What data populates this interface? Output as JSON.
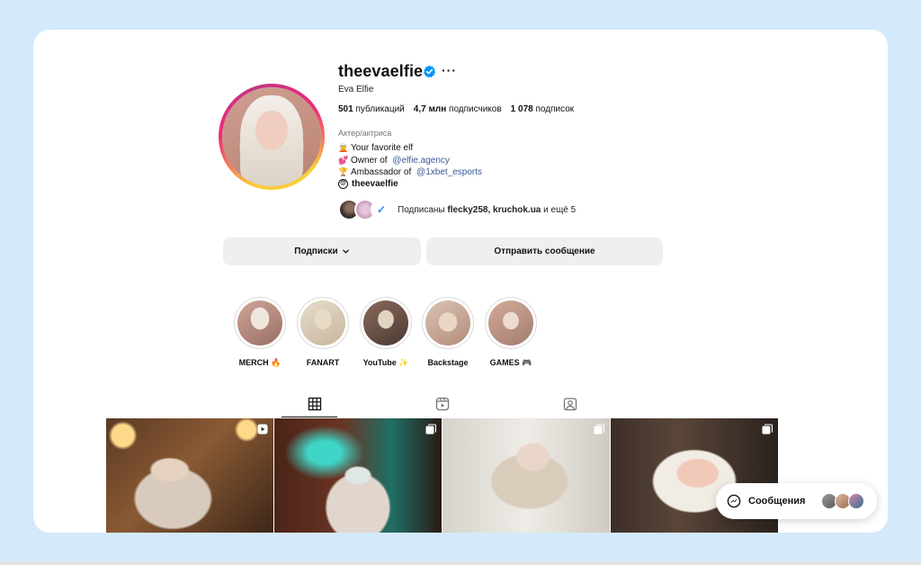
{
  "profile": {
    "username": "theevaelfie",
    "full_name": "Eva Elfie",
    "verified": true,
    "more_label": "···",
    "stats": {
      "posts_value": "501",
      "posts_label": "публикаций",
      "followers_value": "4,7 млн",
      "followers_label": "подписчиков",
      "following_value": "1 078",
      "following_label": "подписок"
    },
    "category": "Актер/актриса",
    "bio": [
      {
        "emoji": "🧝",
        "text": "Your favorite elf",
        "link": ""
      },
      {
        "emoji": "💕",
        "text": "Owner of ",
        "link": "@elfie.agency"
      },
      {
        "emoji": "🏆",
        "text": "Ambassador of ",
        "link": "@1xbet_esports"
      }
    ],
    "threads_handle": "theevaelfie",
    "followed_by": {
      "prefix": "Подписаны ",
      "names": "flecky258, kruchok.ua",
      "suffix": " и ещё 5"
    }
  },
  "actions": {
    "following_label": "Подписки",
    "message_label": "Отправить сообщение"
  },
  "highlights": [
    {
      "label": "MERCH 🔥"
    },
    {
      "label": "FANART"
    },
    {
      "label": "YouTube ✨"
    },
    {
      "label": "Backstage"
    },
    {
      "label": "GAMES 🎮"
    }
  ],
  "tabs": [
    {
      "name": "posts-grid",
      "icon": "grid-icon",
      "active": true
    },
    {
      "name": "reels",
      "icon": "reels-icon",
      "active": false
    },
    {
      "name": "tagged",
      "icon": "tagged-icon",
      "active": false
    }
  ],
  "posts": [
    {
      "type": "reel",
      "icon": "reel-icon"
    },
    {
      "type": "carousel",
      "icon": "carousel-icon"
    },
    {
      "type": "carousel",
      "icon": "carousel-icon"
    },
    {
      "type": "carousel",
      "icon": "carousel-icon"
    }
  ],
  "messages": {
    "label": "Сообщения"
  },
  "colors": {
    "background": "#d4e9fb",
    "verified": "#0095f6",
    "link": "#385898",
    "button": "#efefef"
  }
}
